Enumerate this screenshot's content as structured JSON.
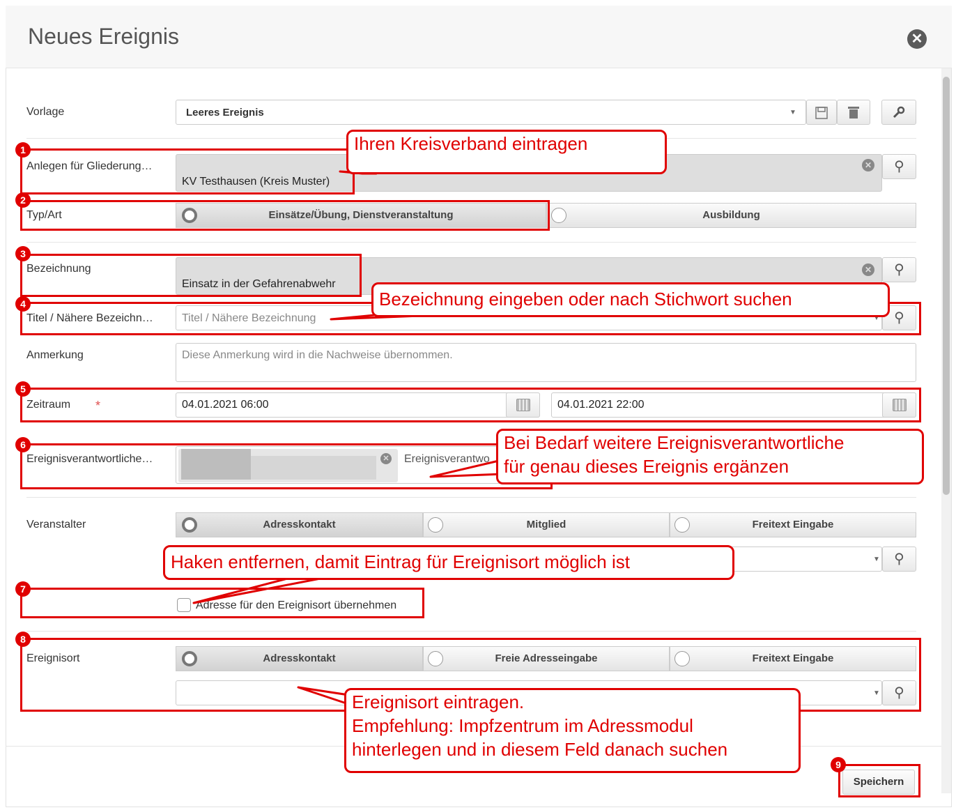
{
  "dialog": {
    "title": "Neues Ereignis"
  },
  "vorlage": {
    "label": "Vorlage",
    "value": "Leeres Ereignis"
  },
  "gliederung": {
    "label": "Anlegen für Gliederung…",
    "value": "KV Testhausen (Kreis Muster)"
  },
  "typ": {
    "label": "Typ/Art",
    "options": [
      "Einsätze/Übung, Dienstveranstaltung",
      "Ausbildung"
    ]
  },
  "bezeichnung": {
    "label": "Bezeichnung",
    "value": "Einsatz in der Gefahrenabwehr"
  },
  "titel": {
    "label": "Titel / Nähere Bezeichn…",
    "placeholder": "Titel / Nähere Bezeichnung"
  },
  "anmerkung": {
    "label": "Anmerkung",
    "placeholder": "Diese Anmerkung wird in die Nachweise übernommen."
  },
  "zeitraum": {
    "label": "Zeitraum",
    "required_mark": "*",
    "start": "04.01.2021 06:00",
    "end": "04.01.2021 22:00"
  },
  "verantwortliche": {
    "label": "Ereignisverantwortliche…",
    "placeholder": "Ereignisverantwo"
  },
  "veranstalter": {
    "label": "Veranstalter",
    "options": [
      "Adresskontakt",
      "Mitglied",
      "Freitext Eingabe"
    ]
  },
  "adresse_checkbox": {
    "label": "Adresse für den Ereignisort übernehmen"
  },
  "ereignisort": {
    "label": "Ereignisort",
    "options": [
      "Adresskontakt",
      "Freie Adresseingabe",
      "Freitext Eingabe"
    ]
  },
  "save_label": "Speichern",
  "callouts": {
    "c1": "Ihren Kreisverband eintragen",
    "c4": "Bezeichnung eingeben oder nach Stichwort suchen",
    "c6a": "Bei Bedarf weitere Ereignisverantwortliche",
    "c6b": "für genau dieses Ereignis ergänzen",
    "c7": "Haken entfernen, damit Eintrag für Ereignisort möglich ist",
    "c8a": "Ereignisort eintragen.",
    "c8b": "Empfehlung: Impfzentrum im Adressmodul",
    "c8c": "hinterlegen und in diesem Feld danach suchen"
  },
  "markers": [
    "1",
    "2",
    "3",
    "4",
    "5",
    "6",
    "7",
    "8",
    "9"
  ],
  "icons": {
    "close": "⊗",
    "search": "⚲",
    "dropdown": "▾",
    "wrench": "wrench-icon",
    "save": "floppy-icon",
    "trash": "trash-icon",
    "calendar": "calendar-icon"
  },
  "colors": {
    "annotation": "#e00000"
  }
}
